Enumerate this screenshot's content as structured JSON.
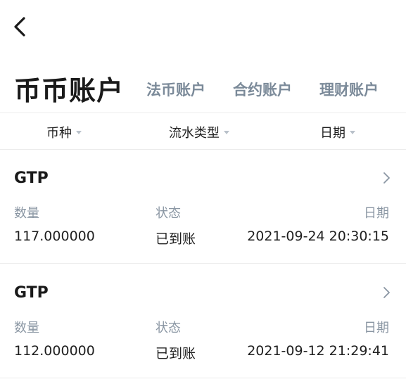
{
  "header": {
    "back_icon": "chevron-left-icon"
  },
  "tabs": [
    {
      "label": "币币账户",
      "active": true
    },
    {
      "label": "法币账户",
      "active": false
    },
    {
      "label": "合约账户",
      "active": false
    },
    {
      "label": "理财账户",
      "active": false
    }
  ],
  "filters": [
    {
      "label": "币种",
      "icon": "caret-down-icon"
    },
    {
      "label": "流水类型",
      "icon": "caret-down-icon"
    },
    {
      "label": "日期",
      "icon": "caret-down-icon"
    }
  ],
  "records": [
    {
      "coin": "GTP",
      "quantity_label": "数量",
      "quantity": "117.000000",
      "status_label": "状态",
      "status": "已到账",
      "date_label": "日期",
      "date": "2021-09-24 20:30:15"
    },
    {
      "coin": "GTP",
      "quantity_label": "数量",
      "quantity": "112.000000",
      "status_label": "状态",
      "status": "已到账",
      "date_label": "日期",
      "date": "2021-09-12 21:29:41"
    }
  ],
  "colors": {
    "primary_text": "#1a1a1a",
    "inactive_tab": "#7b8a99",
    "label_text": "#8a96a3",
    "divider": "#ececec",
    "caret": "#b9c1ca"
  }
}
